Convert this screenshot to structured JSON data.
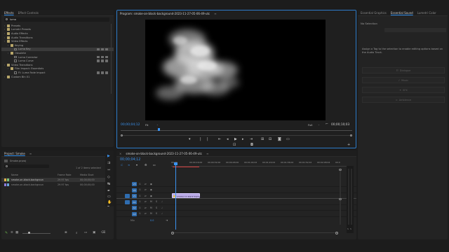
{
  "effects_panel": {
    "tabs": [
      "Effects",
      "Effect Controls"
    ],
    "search_value": "luma",
    "tree": [
      {
        "label": "Presets",
        "indent": 1,
        "kind": "folder"
      },
      {
        "label": "Lumetri Presets",
        "indent": 1,
        "kind": "folder"
      },
      {
        "label": "Audio Effects",
        "indent": 1,
        "kind": "folder"
      },
      {
        "label": "Audio Transitions",
        "indent": 1,
        "kind": "folder"
      },
      {
        "label": "Video Effects",
        "indent": 1,
        "kind": "folder"
      },
      {
        "label": "Keying",
        "indent": 2,
        "kind": "folder"
      },
      {
        "label": "Luma Key",
        "indent": 3,
        "kind": "effect",
        "selected": true
      },
      {
        "label": "Obsolete",
        "indent": 2,
        "kind": "folder"
      },
      {
        "label": "Luma Corrector",
        "indent": 3,
        "kind": "effect"
      },
      {
        "label": "Luma Curve",
        "indent": 3,
        "kind": "effect"
      },
      {
        "label": "Video Transitions",
        "indent": 1,
        "kind": "folder"
      },
      {
        "label": "Film Impact: Essentials",
        "indent": 2,
        "kind": "folder"
      },
      {
        "label": "FI: Luma Fade Impact",
        "indent": 3,
        "kind": "effect"
      },
      {
        "label": "Custom Bin 01",
        "indent": 1,
        "kind": "folder"
      }
    ]
  },
  "program_monitor": {
    "title": "Program: smoke-on-black-background-2023-11-27-05-06-49-utc",
    "timecode": "00;00;04;12",
    "zoom": "Fit",
    "quality": "Full",
    "duration": "00;00;10;03"
  },
  "right_panel": {
    "tabs": [
      "Essential Graphics",
      "Essential Sound",
      "Lumetri Color"
    ],
    "no_selection": "No Selection",
    "message": "Assign a Tag to the selection to enable editing options based on the Audio Track.",
    "buttons": [
      "Dialogue",
      "Music",
      "SFX",
      "Ambience"
    ]
  },
  "project_panel": {
    "tab": "Project: Smoke",
    "subtitle": "Smoke.prproj",
    "items_selected": "1 of 2 items selected",
    "columns": [
      "Name",
      "Frame Rate",
      "Media Start"
    ],
    "rows": [
      {
        "name": "smoke-on-black-backgroun",
        "frame_rate": "29.97 fps",
        "media_start": "00;00;00;00",
        "color": "#e3b24a"
      },
      {
        "name": "smoke-on-black-backgroun",
        "frame_rate": "29.97 fps",
        "media_start": "00;00;00;00",
        "color": "#8a7ad8"
      }
    ]
  },
  "timeline": {
    "tab": "smoke-on-black-background-2023-11-27-05-06-49-utc",
    "timecode": "00;00;04;12",
    "ruler": [
      "00;00",
      "00;00;16;00",
      "00;00;32;00",
      "00;00;48;00",
      "00;01;04;02",
      "00;01;20;02",
      "00;01;36;02",
      "00;01;52;02",
      "00;02;08;04",
      "00;0"
    ],
    "video_tracks": [
      "V3",
      "V2",
      "V1"
    ],
    "audio_tracks": [
      "A1",
      "A2",
      "A3"
    ],
    "mix_label": "Mix",
    "mix_value": "0.0",
    "clip_label": "smoke-on-black-backgr",
    "meter_labels": [
      "S",
      "S"
    ]
  }
}
